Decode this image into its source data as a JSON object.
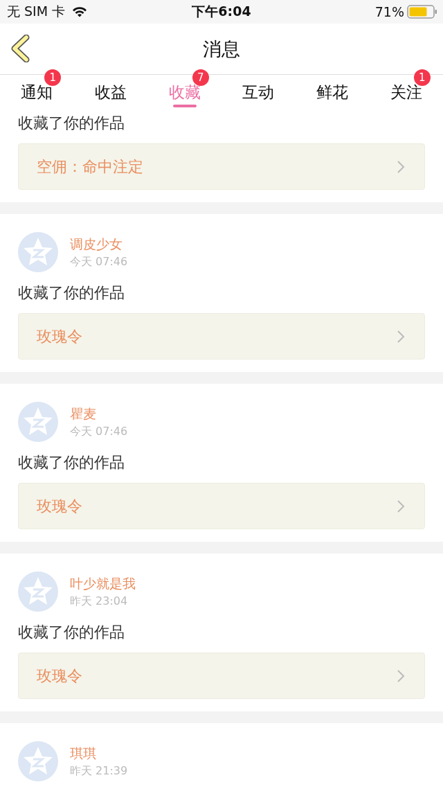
{
  "status_bar": {
    "carrier": "无 SIM 卡",
    "time": "下午6:04",
    "battery": "71%"
  },
  "nav": {
    "title": "消息"
  },
  "tabs": [
    {
      "label": "通知",
      "selected": false,
      "badge": "1"
    },
    {
      "label": "收益",
      "selected": false
    },
    {
      "label": "收藏",
      "selected": true,
      "badge": "7"
    },
    {
      "label": "互动",
      "selected": false
    },
    {
      "label": "鲜花",
      "selected": false
    },
    {
      "label": "关注",
      "selected": false,
      "badge": "1"
    }
  ],
  "messages": [
    {
      "action": "收藏了你的作品",
      "work": "空佣：命中注定"
    },
    {
      "user": "调皮少女",
      "time": "今天 07:46",
      "action": "收藏了你的作品",
      "work": "玫瑰令"
    },
    {
      "user": "瞿麦",
      "time": "今天 07:46",
      "action": "收藏了你的作品",
      "work": "玫瑰令"
    },
    {
      "user": "叶少就是我",
      "time": "昨天 23:04",
      "action": "收藏了你的作品",
      "work": "玫瑰令"
    },
    {
      "user": "琪琪",
      "time": "昨天 21:39"
    }
  ]
}
